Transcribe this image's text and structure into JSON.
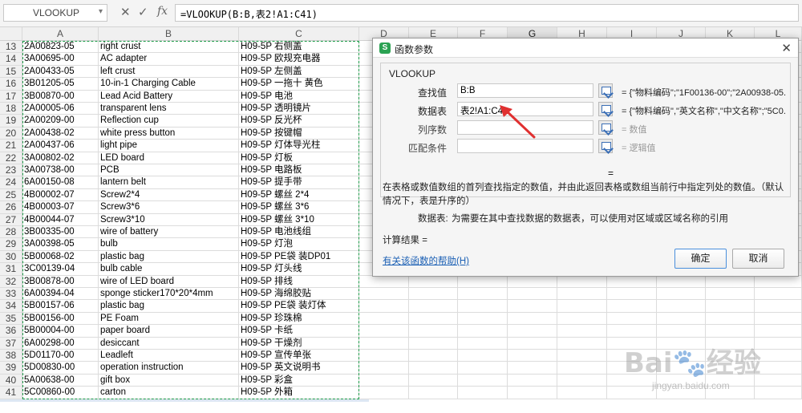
{
  "formula_bar": {
    "name_box": "VLOOKUP",
    "cancel_glyph": "✕",
    "confirm_glyph": "✓",
    "fx_label": "fx",
    "formula": "=VLOOKUP(B:B,表2!A1:C41)"
  },
  "columns": [
    "A",
    "B",
    "C",
    "D",
    "E",
    "F",
    "G",
    "H",
    "I",
    "J",
    "K",
    "L"
  ],
  "selected_column": "G",
  "rows": [
    {
      "n": "13",
      "a": "2A00823-05",
      "b": "right crust",
      "c": "H09-5P 右侧盖"
    },
    {
      "n": "14",
      "a": "3A00695-00",
      "b": "AC adapter",
      "c": "H09-5P 欧规充电器"
    },
    {
      "n": "15",
      "a": "2A00433-05",
      "b": "left crust",
      "c": "H09-5P 左侧盖"
    },
    {
      "n": "16",
      "a": "3B01205-05",
      "b": "10-in-1 Charging Cable",
      "c": "H09-5P 一拖十 黄色"
    },
    {
      "n": "17",
      "a": "3B00870-00",
      "b": "Lead Acid Battery",
      "c": "H09-5P 电池"
    },
    {
      "n": "18",
      "a": "2A00005-06",
      "b": "transparent lens",
      "c": "H09-5P 透明镜片"
    },
    {
      "n": "19",
      "a": "2A00209-00",
      "b": "Reflection cup",
      "c": "H09-5P 反光杯"
    },
    {
      "n": "20",
      "a": "2A00438-02",
      "b": "white press button",
      "c": "H09-5P 按键帽"
    },
    {
      "n": "21",
      "a": "2A00437-06",
      "b": "light pipe",
      "c": "H09-5P 灯体导光柱"
    },
    {
      "n": "22",
      "a": "3A00802-02",
      "b": "LED board",
      "c": "H09-5P 灯板"
    },
    {
      "n": "23",
      "a": "3A00738-00",
      "b": "PCB",
      "c": "H09-5P 电路板"
    },
    {
      "n": "24",
      "a": "6A00150-08",
      "b": "lantern belt",
      "c": "H09-5P 提手带"
    },
    {
      "n": "25",
      "a": "4B00002-07",
      "b": "Screw2*4",
      "c": "H09-5P 螺丝 2*4"
    },
    {
      "n": "26",
      "a": "4B00003-07",
      "b": "Screw3*6",
      "c": "H09-5P 螺丝 3*6"
    },
    {
      "n": "27",
      "a": "4B00044-07",
      "b": "Screw3*10",
      "c": "H09-5P 螺丝 3*10"
    },
    {
      "n": "28",
      "a": "3B00335-00",
      "b": "wire of battery",
      "c": "H09-5P 电池线组"
    },
    {
      "n": "29",
      "a": "3A00398-05",
      "b": "bulb",
      "c": "H09-5P 灯泡"
    },
    {
      "n": "30",
      "a": "5B00068-02",
      "b": "plastic bag",
      "c": "H09-5P PE袋 装DP01"
    },
    {
      "n": "31",
      "a": "3C00139-04",
      "b": "bulb cable",
      "c": "H09-5P 灯头线"
    },
    {
      "n": "32",
      "a": "3B00878-00",
      "b": "wire of LED  board",
      "c": "H09-5P 排线"
    },
    {
      "n": "33",
      "a": "6A00394-04",
      "b": "sponge sticker170*20*4mm",
      "c": "H09-5P 海绵胶贴"
    },
    {
      "n": "34",
      "a": "5B00157-06",
      "b": "plastic bag",
      "c": "H09-5P PE袋 装灯体"
    },
    {
      "n": "35",
      "a": "5B00156-00",
      "b": "PE Foam",
      "c": "H09-5P 珍珠棉"
    },
    {
      "n": "36",
      "a": "5B00004-00",
      "b": "paper board",
      "c": "H09-5P 卡纸"
    },
    {
      "n": "37",
      "a": "6A00298-00",
      "b": "desiccant",
      "c": "H09-5P 干燥剂"
    },
    {
      "n": "38",
      "a": "5D01170-00",
      "b": "Leadleft",
      "c": "H09-5P 宣传单张"
    },
    {
      "n": "39",
      "a": "5D00830-00",
      "b": "operation instruction",
      "c": "H09-5P 英文说明书"
    },
    {
      "n": "40",
      "a": "5A00638-00",
      "b": "gift box",
      "c": "H09-5P 彩盒"
    },
    {
      "n": "41",
      "a": "5C00860-00",
      "b": "carton",
      "c": "H09-5P 外箱"
    }
  ],
  "dialog": {
    "title": "函数参数",
    "close_glyph": "✕",
    "logo_letter": "S",
    "function_name": "VLOOKUP",
    "args": [
      {
        "label": "查找值",
        "value": "B:B",
        "result": "= {\"物料编码\";\"1F00136-00\";\"2A00938-05..."
      },
      {
        "label": "数据表",
        "value": "表2!A1:C41",
        "result": "= {\"物料编码\",\"英文名称\",\"中文名称\";\"5C0..."
      },
      {
        "label": "列序数",
        "value": "",
        "result": "= 数值"
      },
      {
        "label": "匹配条件",
        "value": "",
        "result": "= 逻辑值"
      }
    ],
    "equals": "=",
    "description": "在表格或数值数组的首列查找指定的数值，并由此返回表格或数组当前行中指定列处的数值。（默认情况下，表是升序的）",
    "arg_desc_label": "数据表:",
    "arg_desc_text": "为需要在其中查找数据的数据表，可以使用对区域或区域名称的引用",
    "result_label": "计算结果  =",
    "help_link": "有关该函数的帮助(H)",
    "ok_label": "确定",
    "cancel_label": "取消"
  },
  "watermark": {
    "main": "Bai🐾经验",
    "sub": "jingyan.baidu.com"
  },
  "colors": {
    "accent_green": "#1e9c49",
    "link_blue": "#1a5fb4",
    "arrow_red": "#e03030"
  }
}
